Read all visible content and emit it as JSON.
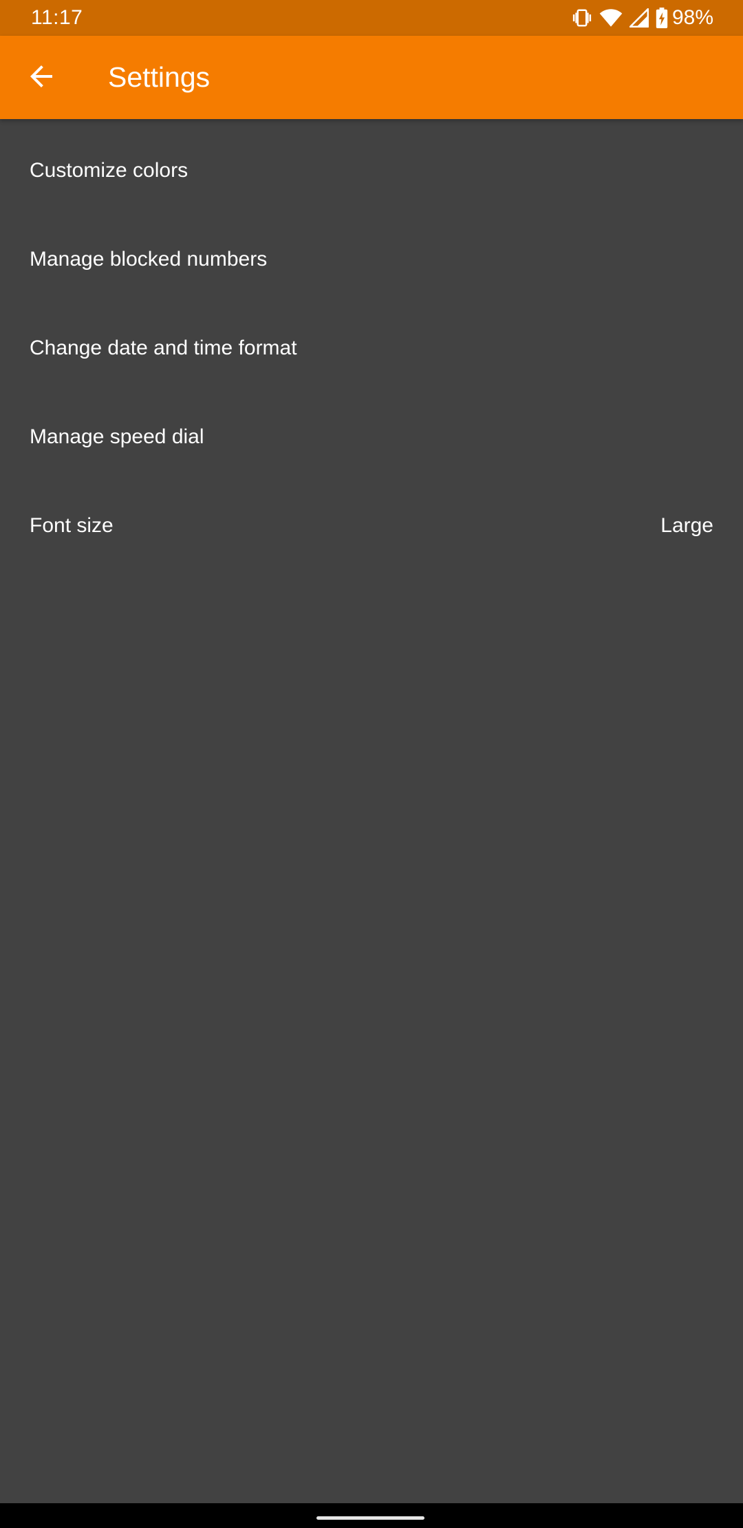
{
  "status_bar": {
    "time": "11:17",
    "battery_percent": "98%",
    "icons": [
      "vibrate-icon",
      "wifi-icon",
      "cell-signal-icon",
      "battery-charging-icon"
    ]
  },
  "app_bar": {
    "title": "Settings",
    "back_icon": "arrow-back-icon"
  },
  "settings": {
    "items": [
      {
        "label": "Customize colors"
      },
      {
        "label": "Manage blocked numbers"
      },
      {
        "label": "Change date and time format"
      },
      {
        "label": "Manage speed dial"
      },
      {
        "label": "Font size",
        "value": "Large"
      }
    ]
  },
  "colors": {
    "status_bar": "#CC6A00",
    "app_bar": "#F57C00",
    "background": "#424242",
    "text": "#FFFFFF"
  }
}
